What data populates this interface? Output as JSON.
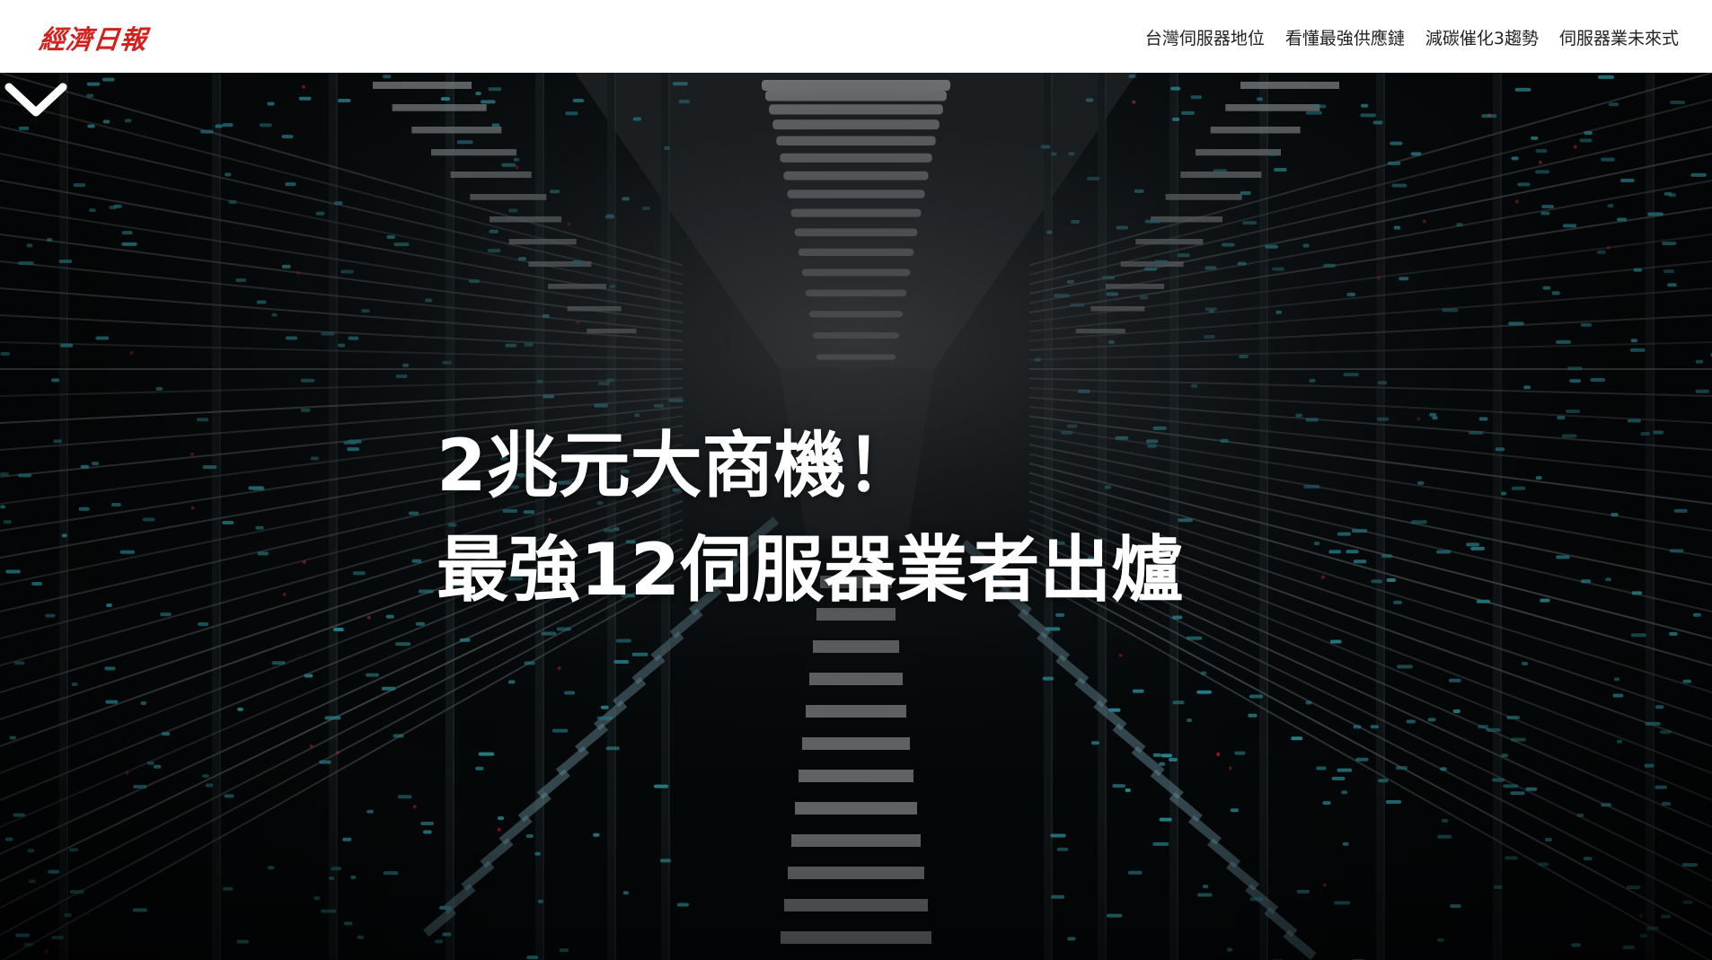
{
  "header": {
    "logo_text": "經濟日報",
    "nav": [
      {
        "label": "台灣伺服器地位"
      },
      {
        "label": "看懂最強供應鏈"
      },
      {
        "label": "減碳催化3趨勢"
      },
      {
        "label": "伺服器業未來式"
      }
    ]
  },
  "hero": {
    "background": "server-room-corridor",
    "headline_line1": "2兆元大商機！",
    "headline_line2": "最強12伺服器業者出爐",
    "scroll_icon": "chevron-down-icon"
  },
  "colors": {
    "logo_red": "#d3201d",
    "nav_text": "#222222",
    "headline": "#ffffff",
    "led_cyan": "#3fd6e6",
    "led_red": "#e0303a"
  }
}
